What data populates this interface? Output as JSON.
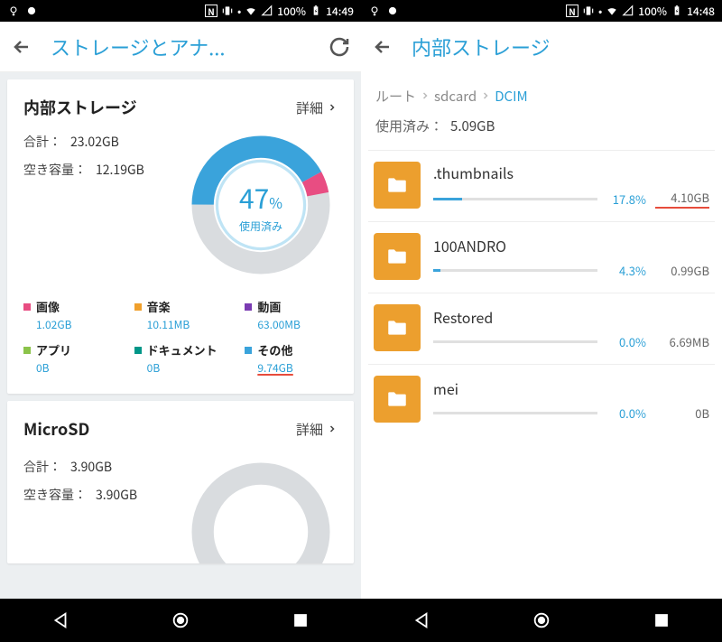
{
  "left": {
    "statusbar": {
      "battery": "100%",
      "time": "14:49"
    },
    "appbar": {
      "title": "ストレージとアナ..."
    },
    "internal": {
      "title": "内部ストレージ",
      "more": "詳細",
      "total_label": "合計：",
      "total_value": "23.02GB",
      "free_label": "空き容量：",
      "free_value": "12.19GB",
      "pct_number": "47",
      "pct_sign": "%",
      "pct_sub": "使用済み",
      "legend": [
        {
          "label": "画像",
          "value": "1.02GB",
          "color": "#e84d82"
        },
        {
          "label": "音楽",
          "value": "10.11MB",
          "color": "#f0a02c"
        },
        {
          "label": "動画",
          "value": "63.00MB",
          "color": "#7a3bb2"
        },
        {
          "label": "アプリ",
          "value": "0B",
          "color": "#8bc34a"
        },
        {
          "label": "ドキュメント",
          "value": "0B",
          "color": "#009688"
        },
        {
          "label": "その他",
          "value": "9.74GB",
          "color": "#3aa3db",
          "underline": true
        }
      ]
    },
    "microsd": {
      "title": "MicroSD",
      "more": "詳細",
      "total_label": "合計：",
      "total_value": "3.90GB",
      "free_label": "空き容量：",
      "free_value": "3.90GB"
    }
  },
  "right": {
    "statusbar": {
      "battery": "100%",
      "time": "14:48"
    },
    "appbar": {
      "title": "内部ストレージ"
    },
    "crumbs": [
      "ルート",
      "sdcard",
      "DCIM"
    ],
    "used_label": "使用済み：",
    "used_value": "5.09GB",
    "folders": [
      {
        "name": ".thumbnails",
        "pct": "17.8%",
        "size": "4.10GB",
        "fill": 17.8,
        "red": true
      },
      {
        "name": "100ANDRO",
        "pct": "4.3%",
        "size": "0.99GB",
        "fill": 4.3
      },
      {
        "name": "Restored",
        "pct": "0.0%",
        "size": "6.69MB",
        "fill": 0
      },
      {
        "name": "mei",
        "pct": "0.0%",
        "size": "0B",
        "fill": 0
      }
    ]
  },
  "chart_data": {
    "type": "pie",
    "title": "内部ストレージ使用済み 47%",
    "total_gb": 23.02,
    "free_gb": 12.19,
    "used_pct": 47,
    "series": [
      {
        "name": "画像",
        "value": "1.02GB",
        "color": "#e84d82"
      },
      {
        "name": "音楽",
        "value": "10.11MB",
        "color": "#f0a02c"
      },
      {
        "name": "動画",
        "value": "63.00MB",
        "color": "#7a3bb2"
      },
      {
        "name": "アプリ",
        "value": "0B",
        "color": "#8bc34a"
      },
      {
        "name": "ドキュメント",
        "value": "0B",
        "color": "#009688"
      },
      {
        "name": "その他",
        "value": "9.74GB",
        "color": "#3aa3db"
      },
      {
        "name": "空き",
        "value": "12.19GB",
        "color": "#d9dcdf"
      }
    ]
  }
}
